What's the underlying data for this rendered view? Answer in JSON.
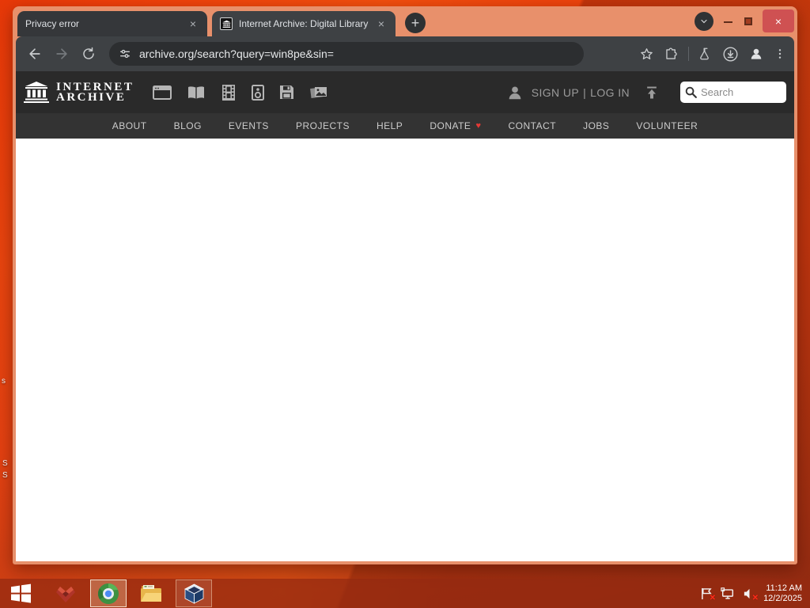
{
  "window": {
    "tabs": [
      {
        "title": "Privacy error",
        "active": false
      },
      {
        "title": "Internet Archive: Digital Library",
        "active": true
      }
    ],
    "tab_close_glyph": "×",
    "new_tab_glyph": "+",
    "controls": {
      "close": "×"
    },
    "toolbar": {
      "url": "archive.org/search?query=win8pe&sin="
    }
  },
  "site": {
    "logo": {
      "line1": "INTERNET",
      "line2": "ARCHIVE"
    },
    "media_types": [
      "web",
      "texts",
      "video",
      "audio",
      "software",
      "images"
    ],
    "account": {
      "sign_up": "SIGN UP",
      "separator": "|",
      "log_in": "LOG IN"
    },
    "search": {
      "placeholder": "Search"
    },
    "nav": [
      "ABOUT",
      "BLOG",
      "EVENTS",
      "PROJECTS",
      "HELP",
      "DONATE",
      "CONTACT",
      "JOBS",
      "VOLUNTEER"
    ],
    "donate_heart_glyph": "♥"
  },
  "taskbar": {
    "apps": [
      "windows-start",
      "red-app",
      "chrome",
      "file-explorer",
      "virtualbox"
    ],
    "tray": {
      "time": "11:12 AM",
      "date": "12/2/2025"
    }
  },
  "desktop": {
    "fragments": [
      "s",
      "S",
      "S"
    ]
  },
  "colors": {
    "frame": "#e8906b",
    "close_button": "#cf5152",
    "toolbar_bg": "#3e4144",
    "tab_inactive_bg": "#35373a",
    "urlbar_bg": "#2c2e30",
    "site_header_bg": "#2a2a2a",
    "site_nav_bg": "#333333",
    "donate_heart": "#e53935",
    "desktop_orange": "#ef4a10",
    "taskbar_tint": "#942a10",
    "search_box_bg": "#ffffff"
  }
}
